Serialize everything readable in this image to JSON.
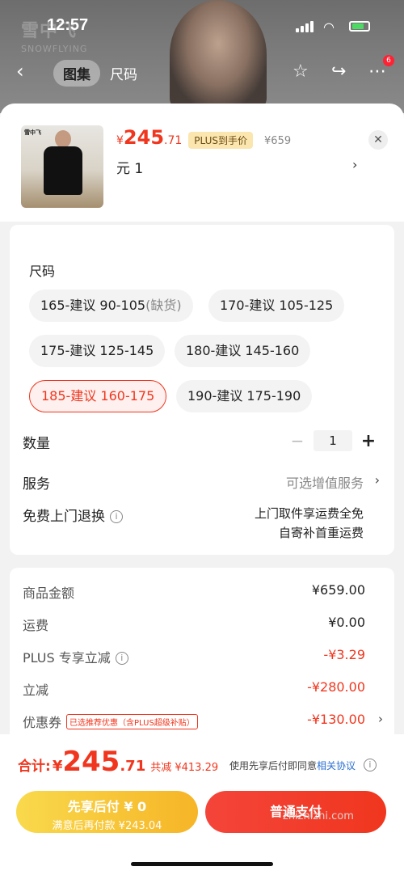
{
  "status": {
    "time": "12:57",
    "brand": "雪中飞",
    "brand_sub": "SNOWFLYING"
  },
  "topnav": {
    "tabs": [
      "图集",
      "尺码"
    ],
    "cart_badge": "6"
  },
  "product": {
    "price_currency": "¥",
    "price_int": "245",
    "price_dec": ".71",
    "plus_tag": "PLUS到手价",
    "original_price": "¥659",
    "selection_text": "元  1",
    "arrow": "›",
    "close": "✕",
    "thumb_logo": "雪中飞"
  },
  "size": {
    "label": "尺码",
    "options": [
      {
        "text": "165-建议 90-105",
        "extra": "(缺货)"
      },
      {
        "text": "170-建议 105-125",
        "extra": ""
      },
      {
        "text": "175-建议 125-145",
        "extra": ""
      },
      {
        "text": "180-建议 145-160",
        "extra": ""
      },
      {
        "text": "185-建议 160-175",
        "extra": ""
      },
      {
        "text": "190-建议 175-190",
        "extra": ""
      }
    ],
    "selected_index": 4
  },
  "quantity": {
    "label": "数量",
    "minus": "−",
    "value": "1",
    "plus": "+"
  },
  "service": {
    "label": "服务",
    "value": "可选增值服务",
    "arrow": "›"
  },
  "return": {
    "label": "免费上门退换",
    "info": "i",
    "line1": "上门取件享运费全免",
    "line2": "自寄补首重运费"
  },
  "fees": {
    "goods_label": "商品金额",
    "goods_value": "¥659.00",
    "shipping_label": "运费",
    "shipping_value": "¥0.00",
    "plus_label": "PLUS 专享立减",
    "plus_value": "-¥3.29",
    "reduce_label": "立减",
    "reduce_value": "-¥280.00",
    "coupon_label": "优惠券",
    "coupon_tag": "已选推荐优惠（含PLUS超级补贴）",
    "coupon_value": "-¥130.00",
    "arrow": "›"
  },
  "footer": {
    "total_label": "合计:",
    "total_currency": "¥",
    "total_int": "245",
    "total_dec": ".71",
    "total_save": "共减 ¥413.29",
    "agree_text": "使用先享后付即同意",
    "agree_link": "相关协议",
    "info": "i",
    "pay_later_line1": "先享后付 ¥ 0",
    "pay_later_line2": "满意后再付款 ¥243.04",
    "pay_button": "普通支付",
    "watermark": "zhizhizhi.com"
  },
  "colors": {
    "accent": "#f0361e",
    "pay_later": "#f6b527",
    "link": "#2b6fd1"
  }
}
